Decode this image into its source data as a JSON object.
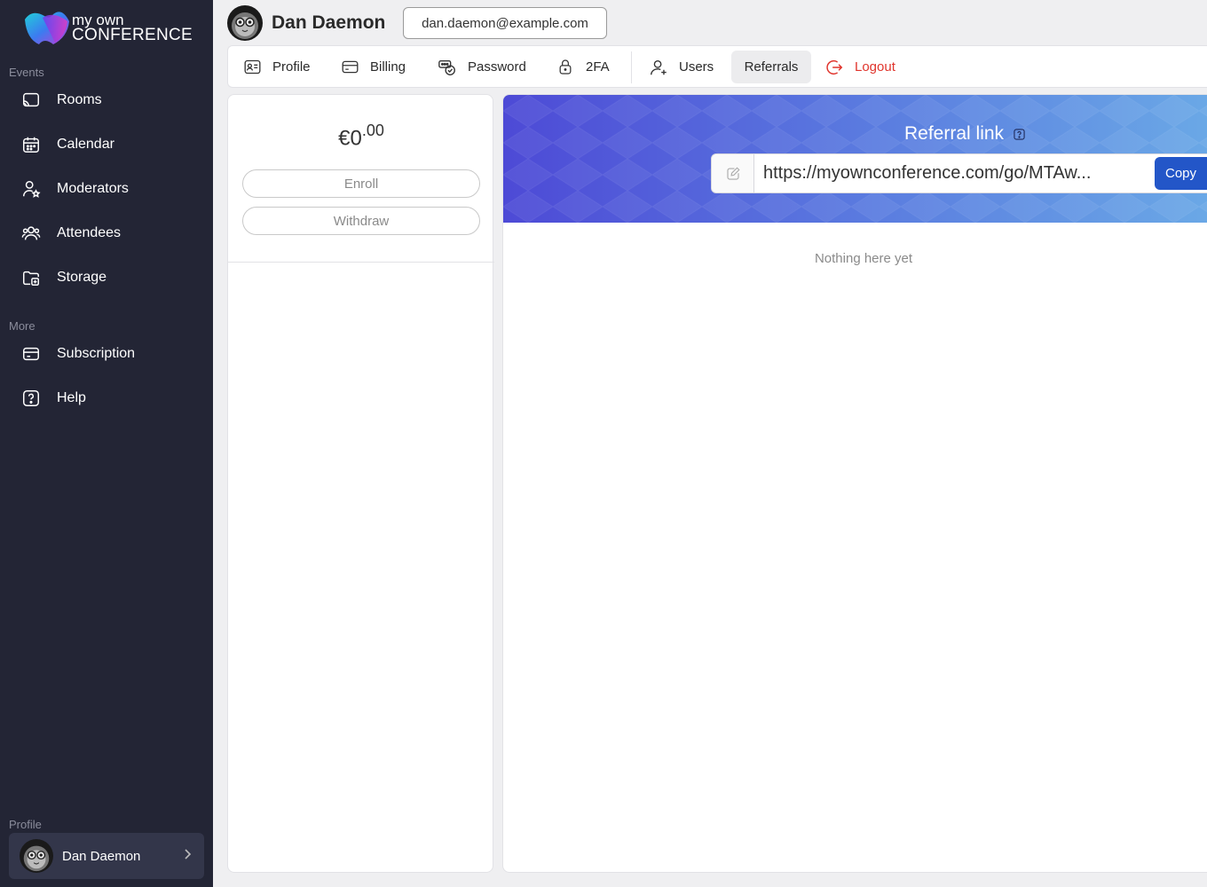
{
  "brand": {
    "line1": "my own",
    "line2": "CONFERENCE"
  },
  "sidebar": {
    "events_label": "Events",
    "events_items": [
      {
        "label": "Rooms",
        "icon": "cast-icon"
      },
      {
        "label": "Calendar",
        "icon": "calendar-icon"
      },
      {
        "label": "Moderators",
        "icon": "moderator-icon"
      },
      {
        "label": "Attendees",
        "icon": "attendees-icon"
      },
      {
        "label": "Storage",
        "icon": "folder-icon"
      }
    ],
    "more_label": "More",
    "more_items": [
      {
        "label": "Subscription",
        "icon": "card-icon"
      },
      {
        "label": "Help",
        "icon": "help-icon"
      }
    ],
    "profile_label": "Profile",
    "profile_name": "Dan Daemon"
  },
  "header": {
    "name": "Dan Daemon",
    "email": "dan.daemon@example.com"
  },
  "tabs": [
    {
      "label": "Profile",
      "icon": "id-card-icon"
    },
    {
      "label": "Billing",
      "icon": "wallet-icon"
    },
    {
      "label": "Password",
      "icon": "password-icon"
    },
    {
      "label": "2FA",
      "icon": "lock-icon"
    },
    {
      "label": "Users",
      "icon": "add-user-icon"
    },
    {
      "label": "Referrals",
      "icon": "",
      "active": true
    },
    {
      "label": "Logout",
      "icon": "logout-icon"
    }
  ],
  "balance": {
    "currency": "€",
    "whole": "0",
    "cents": ".00"
  },
  "buttons": {
    "enroll": "Enroll",
    "withdraw": "Withdraw"
  },
  "referral": {
    "title": "Referral link",
    "url": "https://myownconference.com/go/MTAw...",
    "copy": "Copy",
    "empty": "Nothing here yet"
  },
  "colors": {
    "sidebar_bg": "#232535",
    "accent": "#2356c8",
    "logout": "#e0342c"
  }
}
